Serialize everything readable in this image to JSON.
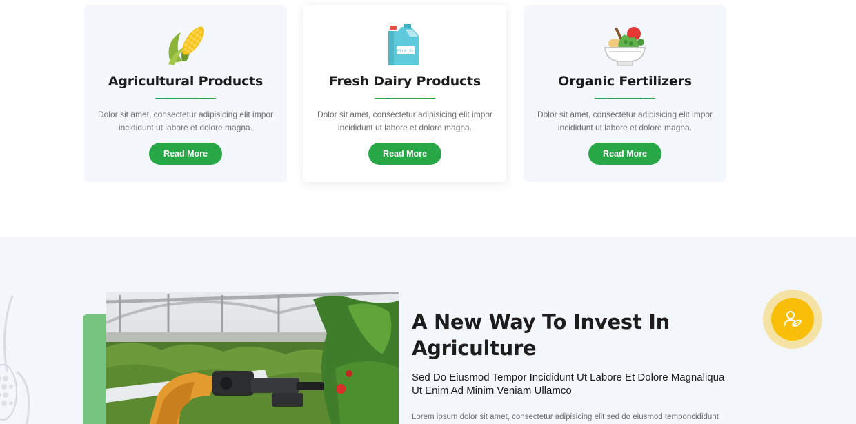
{
  "services": [
    {
      "title": "Agricultural Products",
      "description": "Dolor sit amet, consectetur adipisicing elit impor incididunt ut labore et dolore magna.",
      "button": "Read More",
      "icon": "corn-icon"
    },
    {
      "title": "Fresh Dairy Products",
      "description": "Dolor sit amet, consectetur adipisicing elit impor incididunt ut labore et dolore magna.",
      "button": "Read More",
      "icon": "milk-jug-icon",
      "icon_label": "MILK 5L"
    },
    {
      "title": "Organic Fertilizers",
      "description": "Dolor sit amet, consectetur adipisicing elit impor incididunt ut labore et dolore magna.",
      "button": "Read More",
      "icon": "vegetable-bowl-icon"
    }
  ],
  "invest": {
    "title": "A New Way To Invest In Agriculture",
    "subtitle": "Sed Do Eiusmod Tempor Incididunt Ut Labore Et Dolore Magnaliqua Ut Enim Ad Minim Veniam Ullamco",
    "body": "Lorem ipsum dolor sit amet, consectetur adipisicing elit sed do eiusmod temponcididunt",
    "badge_icon": "farmer-icon",
    "photo": "greenhouse-robot-arm-image"
  },
  "colors": {
    "accent_green": "#27a745",
    "badge_yellow": "#f8be08",
    "card_bg": "#f4f8fd",
    "section_bg": "#f3f6fb"
  }
}
